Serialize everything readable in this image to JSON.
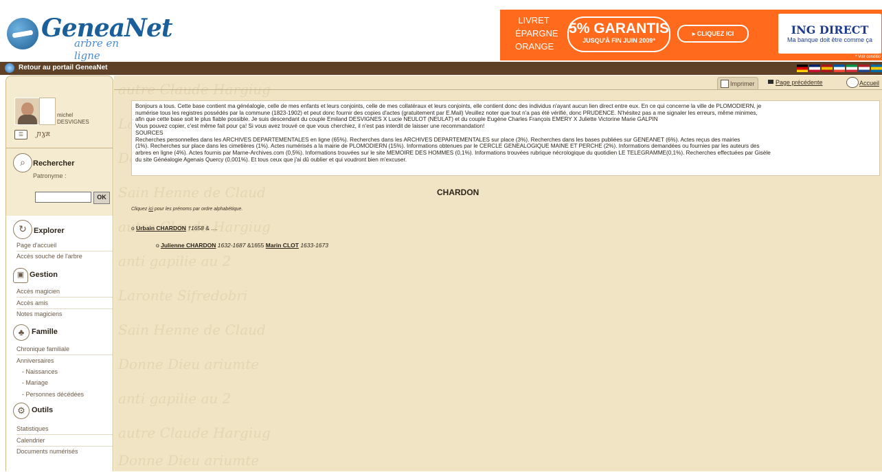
{
  "header": {
    "logo_text": "GeneaNet",
    "logo_tagline": "arbre en ligne",
    "ad": {
      "left_lines": [
        "LIVRET",
        "ÉPARGNE",
        "ORANGE"
      ],
      "rate": "5% GARANTIS",
      "rate_sub": "JUSQU'À FIN JUIN 2009*",
      "cta": "CLIQUEZ ICI",
      "bank": "ING DIRECT",
      "bank_slogan": "Ma banque doit être comme ça",
      "note": "* Voir conditio"
    }
  },
  "nav_bar": {
    "portal_link": "Retour au portail GeneaNet",
    "flags": [
      {
        "name": "german-flag-icon",
        "colors": [
          "#000000",
          "#dd0000",
          "#ffce00"
        ]
      },
      {
        "name": "english-flag-icon",
        "colors": [
          "#012169",
          "#ffffff",
          "#c8102e"
        ]
      },
      {
        "name": "spanish-flag-icon",
        "colors": [
          "#aa151b",
          "#f1bf00",
          "#aa151b"
        ]
      },
      {
        "name": "french-flag-icon",
        "colors": [
          "#0055a4",
          "#ffffff",
          "#ef4135"
        ]
      },
      {
        "name": "italian-flag-icon",
        "colors": [
          "#009246",
          "#ffffff",
          "#ce2b37"
        ]
      },
      {
        "name": "dutch-flag-icon",
        "colors": [
          "#ae1c28",
          "#ffffff",
          "#21468b"
        ]
      },
      {
        "name": "swedish-flag-icon",
        "colors": [
          "#006aa7",
          "#fecc00",
          "#006aa7"
        ]
      }
    ]
  },
  "sidebar": {
    "profile": {
      "first_name": "michel",
      "last_name": "DESVIGNES"
    },
    "search": {
      "title": "Rechercher",
      "patronym_label": "Patronyme :",
      "ok_label": "OK",
      "input_value": ""
    },
    "explore": {
      "title": "Explorer",
      "items": [
        "Page d'accueil",
        "Accès souche de l'arbre"
      ]
    },
    "gestion": {
      "title": "Gestion",
      "items": [
        "Accès magicien",
        "Accès amis",
        "Notes magiciens"
      ]
    },
    "famille": {
      "title": "Famille",
      "items": [
        "Chronique familiale",
        "Anniversaires"
      ],
      "sub_items": [
        "- Naissances",
        "- Mariage",
        "- Personnes décédées"
      ]
    },
    "outils": {
      "title": "Outils",
      "items": [
        "Statistiques",
        "Calendrier",
        "Documents numérisés"
      ]
    }
  },
  "toolbar": {
    "print": "Imprimer",
    "previous": "Page précédente",
    "home": "Accueil"
  },
  "main": {
    "intro_lines": [
      "Bonjours a tous. Cette base contient ma généalogie, celle de mes enfants et leurs conjoints, celle de mes collatéraux et leurs conjoints, elle contient donc des individus n'ayant aucun lien direct entre eux. En ce qui concerne la ville de PLOMODIERN, je",
      "numérise tous les registres possédés par la commune (1823-1902) et peut donc fournir des copies d'actes (gratuitement par E.Mail) Veuillez noter que tout n'a pas été vérifié, donc PRUDENCE. N'hésitez pas a me signaler les erreurs, même minimes,",
      "afin que cette base soit le plus fiable possible. Je suis descendant du couple Emiland DESVIGNES X Lucie NEULOT (NEULAT) et du couple Eugène Charles François EMERY X Juliette Victorine Marie GALPIN",
      "Vous pouvez copier, c'est même fait pour ça! Si vous avez trouvé ce que vous cherchiez, il n'est pas interdit de laisser une recommandation!",
      "SOURCES",
      "Recherches personnelles dans les ARCHIVES DEPARTEMENTALES en ligne (65%). Recherches dans les ARCHIVES DEPARTEMENTALES sur place (3%). Recherches dans les bases publiées sur GENEANET (6%). Actes reçus des mairies",
      "(1%). Recherches sur place dans les cimetières (1%). Actes numérisés a la mairie de PLOMODIERN (15%). Informations obtenues par le CERCLE GENEALOGIQUE MAINE ET PERCHE (2%). Informations demandées ou fournies par les auteurs des",
      "arbres en ligne (4%). Actes fournis par Marne-Archives.com (0,5%). Informations trouvées sur le site MEMOIRE DES HOMMES (0,1%). Informations trouvées  rubrique nécrologique du quotidien LE TELEGRAMME(0,1%). Recherches effectuées par Gisèle",
      "du site Généalogie Agenais Quercy (0,001%). Et tous ceux que j'ai dû oublier et qui voudront bien m'excuser."
    ],
    "surname": "CHARDON",
    "hint_pre": "Cliquez ",
    "hint_link": "ici",
    "hint_post": " pour les prénoms par ordre alphabétique.",
    "tree": [
      {
        "bullet": "o",
        "name": "Urbain CHARDON",
        "dates": "†1658",
        "sep": "& ....",
        "spouse": "",
        "spouse_dates": ""
      },
      {
        "bullet": "o",
        "name": "Julienne CHARDON",
        "dates": "1632-1687",
        "sep": "&1655",
        "spouse": "Marin CLOT",
        "spouse_dates": "1633-1673"
      }
    ],
    "background_script": [
      "autre Claude Hargiug",
      "Laronte Sifredobri",
      "Donne Dieu ariumte",
      "anti gapilie au 2",
      "Sain Henne de Claud"
    ]
  }
}
